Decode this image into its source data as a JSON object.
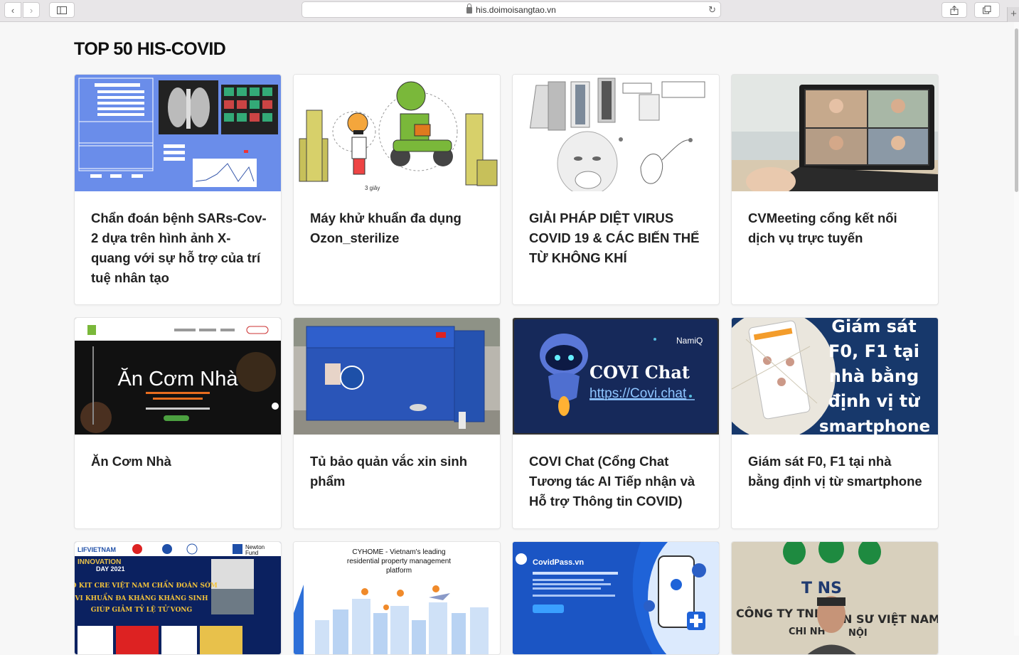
{
  "browser": {
    "url": "his.doimoisangtao.vn"
  },
  "page": {
    "heading": "TOP 50 HIS-COVID"
  },
  "cards": [
    {
      "title": "Chẩn đoán bệnh SARs-Cov-2 dựa trên hình ảnh X-quang với sự hỗ trợ của trí tuệ nhân tạo"
    },
    {
      "title": "Máy khử khuẩn đa dụng Ozon_sterilize"
    },
    {
      "title": "GIẢI PHÁP DIỆT VIRUS COVID 19 & CÁC BIẾN THỂ TỪ KHÔNG KHÍ"
    },
    {
      "title": "CVMeeting cổng kết nối dịch vụ trực tuyến"
    },
    {
      "title": "Ăn Cơm Nhà",
      "thumb_text": "Ăn Cơm Nhà"
    },
    {
      "title": "Tủ bảo quản vắc xin sinh phẩm"
    },
    {
      "title": "COVI Chat (Cổng Chat Tương tác AI Tiếp nhận và Hỗ trợ Thông tin COVID)",
      "thumb_brand": "NamiQ",
      "thumb_title": "COVI Chat",
      "thumb_link": "https://Covi.chat"
    },
    {
      "title": "Giám sát F0, F1 tại nhà bằng định vị từ smartphone",
      "thumb_lines": [
        "Giám sát",
        "F0, F1 tại",
        "nhà bằng",
        "định vị từ",
        "smartphone"
      ]
    },
    {
      "title": "",
      "thumb_top": [
        "LIFVIETNAM",
        "Newton",
        "Fund"
      ],
      "thumb_event": [
        "INNOVATION",
        "DAY 2021"
      ],
      "thumb_lines": [
        "BỘ KIT CRE VIỆT NAM CHẨN ĐOÁN SỚM",
        "VI KHUẨN ĐA KHÁNG KHÁNG SINH",
        "GIÚP GIẢM TỶ LỆ TỬ VONG"
      ]
    },
    {
      "title": "",
      "thumb_lines": [
        "CYHOME - Vietnam's leading",
        "residential property management",
        "platform"
      ]
    },
    {
      "title": "",
      "thumb_brand": "CovidPass.vn"
    },
    {
      "title": "",
      "thumb_sign": "CÔNG TY TNHH",
      "thumb_sign2": "N SƯ VIỆT NAM",
      "thumb_sign3": "CHI NH",
      "thumb_sign4": "NỘI",
      "thumb_logo": "T NS"
    }
  ],
  "colors": {
    "xray_bg": "#6a8dea",
    "covi_bg": "#16295a",
    "gps_bg": "#17386b",
    "freezer_blue": "#2a55b8"
  }
}
